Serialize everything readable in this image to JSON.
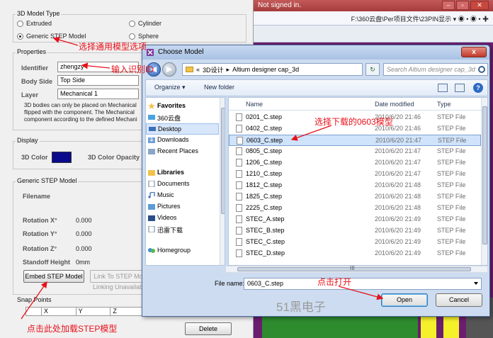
{
  "background_app": {
    "sign_in_text": "Not signed in.",
    "address_path": "F:\\360云盘\\Per项目文件\\23PIN显示 ▾"
  },
  "model_panel": {
    "type_group_title": "3D Model Type",
    "radio_extruded": "Extruded",
    "radio_cylinder": "Cylinder",
    "radio_generic_step": "Generic STEP Model",
    "radio_sphere": "Sphere",
    "properties_title": "Properties",
    "identifier_label": "Identifier",
    "identifier_value": "zhengzy",
    "body_side_label": "Body Side",
    "body_side_value": "Top Side",
    "layer_label": "Layer",
    "layer_value": "Mechanical 1",
    "description_line1": "3D bodies can only be placed on Mechanical",
    "description_line2": "flipped with the component. The Mechanical",
    "description_line3": "component according to the defined Mechani",
    "display_title": "Display",
    "color_label": "3D Color",
    "opacity_label": "3D Color Opacity",
    "generic_step_title": "Generic STEP Model",
    "filename_label": "Filename",
    "rotation_x_label": "Rotation X°",
    "rotation_x_value": "0.000",
    "rotation_y_label": "Rotation Y°",
    "rotation_y_value": "0.000",
    "rotation_z_label": "Rotation Z°",
    "rotation_z_value": "0.000",
    "standoff_label": "Standoff Height",
    "standoff_value": "0mm",
    "embed_button": "Embed STEP Model",
    "link_button": "Link To STEP Mo",
    "linking_text": "Linking Unavailab",
    "snap_title": "Snap Points",
    "snap_col_x": "X",
    "snap_col_y": "Y",
    "snap_col_z": "Z",
    "delete_button": "Delete"
  },
  "dialog": {
    "title": "Choose Model",
    "close_label": "x",
    "path_prefix": "«",
    "path_part1": "3D设计",
    "path_sep": "▸",
    "path_part2": "Altium designer cap_3d",
    "search_placeholder": "Search Altium designer cap_3d",
    "organize_label": "Organize ▾",
    "new_folder_label": "New folder",
    "help_label": "?",
    "nav_items": [
      {
        "label": "Favorites",
        "icon": "star-icon"
      },
      {
        "label": "360云盘",
        "icon": "cloud-drive-icon"
      },
      {
        "label": "Desktop",
        "icon": "desktop-icon"
      },
      {
        "label": "Downloads",
        "icon": "downloads-icon"
      },
      {
        "label": "Recent Places",
        "icon": "recent-places-icon"
      },
      {
        "label": "Libraries",
        "icon": "libraries-icon"
      },
      {
        "label": "Documents",
        "icon": "documents-icon"
      },
      {
        "label": "Music",
        "icon": "music-icon"
      },
      {
        "label": "Pictures",
        "icon": "pictures-icon"
      },
      {
        "label": "Videos",
        "icon": "videos-icon"
      },
      {
        "label": "迅雷下载",
        "icon": "thunder-download-icon"
      },
      {
        "label": "Homegroup",
        "icon": "homegroup-icon"
      }
    ],
    "columns": {
      "name": "Name",
      "date": "Date modified",
      "type": "Type"
    },
    "files": [
      {
        "name": "0201_C.step",
        "date": "2010/6/20 21:46",
        "type": "STEP File"
      },
      {
        "name": "0402_C.step",
        "date": "2010/6/20 21:46",
        "type": "STEP File"
      },
      {
        "name": "0603_C.step",
        "date": "2010/6/20 21:47",
        "type": "STEP File"
      },
      {
        "name": "0805_C.step",
        "date": "2010/6/20 21:47",
        "type": "STEP File"
      },
      {
        "name": "1206_C.step",
        "date": "2010/6/20 21:47",
        "type": "STEP File"
      },
      {
        "name": "1210_C.step",
        "date": "2010/6/20 21:47",
        "type": "STEP File"
      },
      {
        "name": "1812_C.step",
        "date": "2010/6/20 21:48",
        "type": "STEP File"
      },
      {
        "name": "1825_C.step",
        "date": "2010/6/20 21:48",
        "type": "STEP File"
      },
      {
        "name": "2225_C.step",
        "date": "2010/6/20 21:48",
        "type": "STEP File"
      },
      {
        "name": "STEC_A.step",
        "date": "2010/6/20 21:49",
        "type": "STEP File"
      },
      {
        "name": "STEC_B.step",
        "date": "2010/6/20 21:49",
        "type": "STEP File"
      },
      {
        "name": "STEC_C.step",
        "date": "2010/6/20 21:49",
        "type": "STEP File"
      },
      {
        "name": "STEC_D.step",
        "date": "2010/6/20 21:49",
        "type": "STEP File"
      }
    ],
    "selected_index": 2,
    "hscroll_label": "III",
    "file_name_label": "File name:",
    "file_name_value": "0603_C.step",
    "open_button": "Open",
    "cancel_button": "Cancel"
  },
  "annotations": {
    "select_generic": "选择通用模型选项",
    "enter_identifier": "输入识别ID",
    "select_0603": "选择下载的0603模型",
    "click_open": "点击打开",
    "click_load": "点击此处加载STEP模型",
    "watermark": "51黑电子",
    "color": "#e8101a"
  }
}
